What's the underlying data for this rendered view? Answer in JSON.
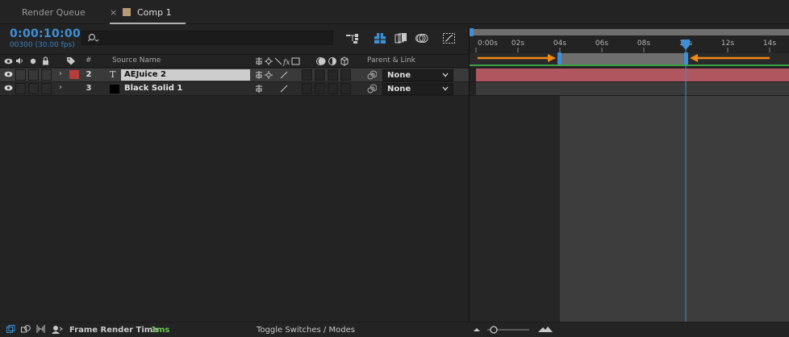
{
  "tabs": [
    {
      "label": "Render Queue"
    },
    {
      "label": "Comp 1",
      "close": "×",
      "menu": "≡",
      "swatch_color": "#b59a7a"
    }
  ],
  "composition": {
    "timecode": "0:00:10:00",
    "frames": "00300 (30.00 fps)"
  },
  "columns": {
    "number": "#",
    "source_name": "Source Name",
    "parent_link": "Parent & Link"
  },
  "layers": [
    {
      "number": "2",
      "name": "AEJuice 2",
      "type_icon": "T",
      "label_color": "#b83c3c",
      "parent": "None",
      "selected": true
    },
    {
      "number": "3",
      "name": "Black Solid 1",
      "type_icon": "",
      "label_color": "#000000",
      "parent": "None",
      "selected": false
    }
  ],
  "timeline": {
    "ticks": [
      "0:00s",
      "02s",
      "04s",
      "06s",
      "08s",
      "10s",
      "12s",
      "14s"
    ],
    "current_time_s": 10,
    "work_area_start_s": 4,
    "work_area_end_s": 10,
    "range_s": [
      0,
      15
    ],
    "layer_bar_color": "#b0565f",
    "arrow_color": "#f08a16",
    "accent": "#3e8fd6"
  },
  "status": {
    "frame_render_label": "Frame Render Time",
    "frame_render_value": "1ms",
    "toggle_label": "Toggle Switches / Modes"
  }
}
